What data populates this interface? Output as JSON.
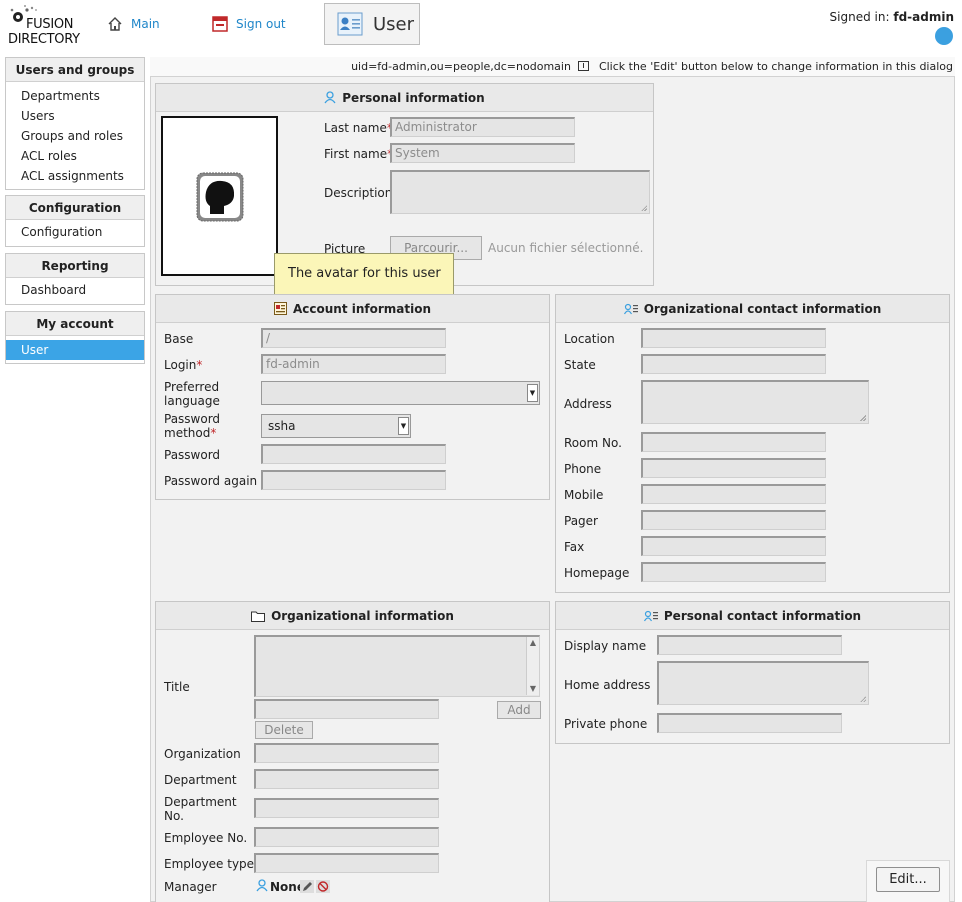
{
  "header": {
    "logo_line1": "FUSION",
    "logo_line2": "DIRECTORY",
    "nav_main": "Main",
    "nav_signout": "Sign out",
    "tab_user": "User",
    "signed_in_label": "Signed in:",
    "signed_in_user": "fd-admin"
  },
  "sidebar": {
    "sections": [
      {
        "title": "Users and groups",
        "items": [
          "Departments",
          "Users",
          "Groups and roles",
          "ACL roles",
          "ACL assignments"
        ]
      },
      {
        "title": "Configuration",
        "items": [
          "Configuration"
        ]
      },
      {
        "title": "Reporting",
        "items": [
          "Dashboard"
        ]
      },
      {
        "title": "My account",
        "items": [
          "User"
        ]
      }
    ],
    "active_item": "User"
  },
  "infobar": {
    "dn": "uid=fd-admin,ou=people,dc=nodomain",
    "hint": "Click the 'Edit' button below to change information in this dialog"
  },
  "personal_info": {
    "title": "Personal information",
    "last_name_label": "Last name",
    "last_name_value": "Administrator",
    "first_name_label": "First name",
    "first_name_value": "System",
    "description_label": "Description",
    "picture_label": "Picture",
    "browse_button": "Parcourir...",
    "no_file": "Aucun fichier sélectionné.",
    "tooltip": "The avatar for this user"
  },
  "account_info": {
    "title": "Account information",
    "base_label": "Base",
    "base_value": "/",
    "login_label": "Login",
    "login_value": "fd-admin",
    "pref_lang_label1": "Preferred",
    "pref_lang_label2": "language",
    "pw_method_label1": "Password",
    "pw_method_label2": "method",
    "pw_method_value": "ssha",
    "password_label": "Password",
    "password_again_label": "Password again"
  },
  "org_contact": {
    "title": "Organizational contact information",
    "location": "Location",
    "state": "State",
    "address": "Address",
    "room": "Room No.",
    "phone": "Phone",
    "mobile": "Mobile",
    "pager": "Pager",
    "fax": "Fax",
    "homepage": "Homepage"
  },
  "org_info": {
    "title": "Organizational information",
    "title_label": "Title",
    "add_button": "Add",
    "delete_button": "Delete",
    "organization": "Organization",
    "department": "Department",
    "department_no1": "Department",
    "department_no2": "No.",
    "employee_no": "Employee No.",
    "employee_type": "Employee type",
    "manager": "Manager",
    "manager_value": "None"
  },
  "personal_contact": {
    "title": "Personal contact information",
    "display_name": "Display name",
    "home_address": "Home address",
    "private_phone": "Private phone"
  },
  "actions": {
    "edit_button": "Edit..."
  },
  "colors": {
    "accent": "#3ba4e6",
    "link": "#1f86c9",
    "required": "#c0282a"
  }
}
